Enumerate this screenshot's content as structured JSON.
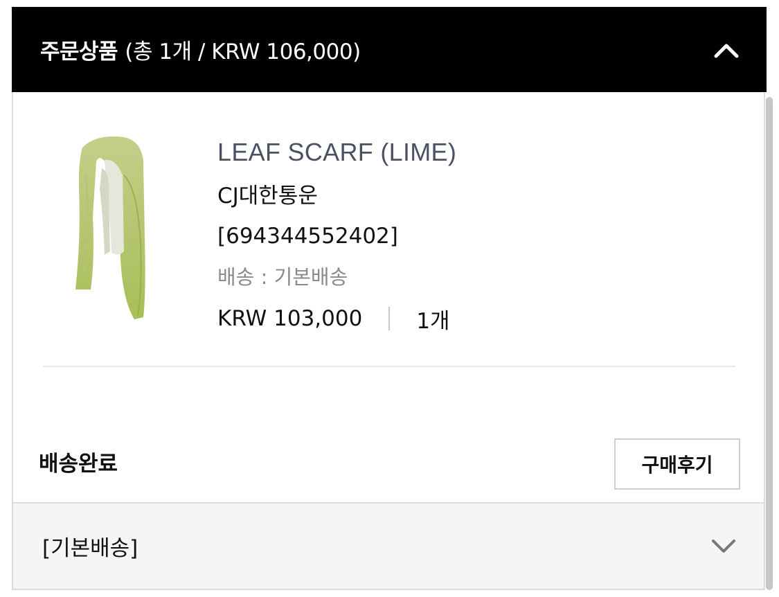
{
  "header": {
    "title": "주문상품",
    "summary": "(총 1개 / KRW 106,000)",
    "collapse_icon": "chevron-up-icon"
  },
  "item": {
    "name": "LEAF SCARF (LIME)",
    "carrier": "CJ대한통운",
    "tracking": "[694344552402]",
    "shipping": "배송 : 기본배송",
    "price": "KRW 103,000",
    "quantity": "1개",
    "image_colors": {
      "green": "#b9c978",
      "light": "#dfe6c4"
    }
  },
  "status": {
    "label": "배송완료",
    "review_button": "구매후기"
  },
  "shipping_section": {
    "label": "[기본배송]",
    "expand_icon": "chevron-down-icon"
  }
}
